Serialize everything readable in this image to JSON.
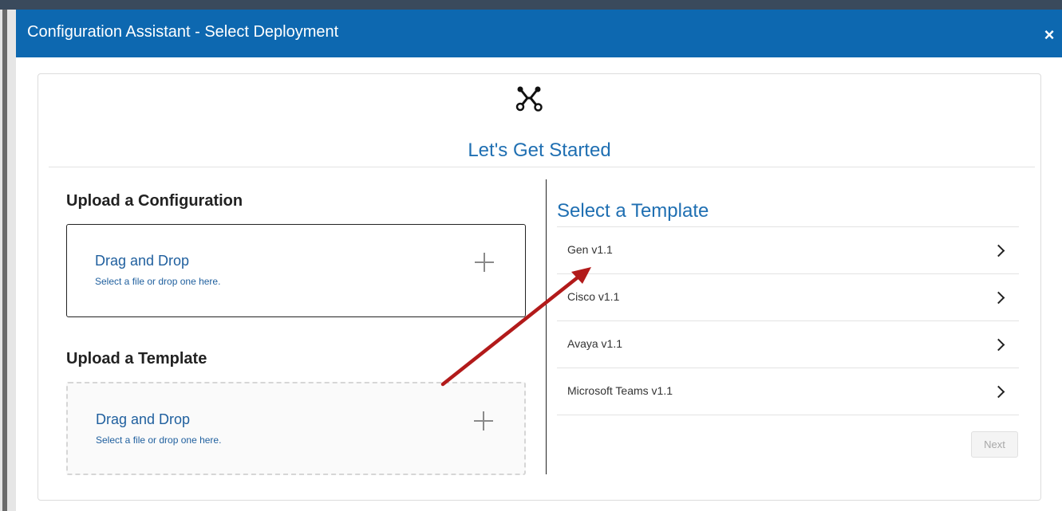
{
  "dialog": {
    "title": "Configuration Assistant - Select Deployment",
    "close_glyph": "×"
  },
  "hero": {
    "icon": "network-nodes-icon",
    "heading": "Let's Get Started"
  },
  "upload_configuration": {
    "title": "Upload a Configuration",
    "dropzone_title": "Drag and Drop",
    "dropzone_hint": "Select a file or drop one here."
  },
  "upload_template": {
    "title": "Upload a Template",
    "dropzone_title": "Drag and Drop",
    "dropzone_hint": "Select a file or drop one here."
  },
  "templates": {
    "title": "Select a Template",
    "items": [
      {
        "label": "Gen v1.1"
      },
      {
        "label": "Cisco v1.1"
      },
      {
        "label": "Avaya v1.1"
      },
      {
        "label": "Microsoft Teams v1.1"
      }
    ],
    "next_label": "Next"
  },
  "colors": {
    "titlebar": "#0d68b0",
    "accent_text": "#1f6fb2",
    "annotation_arrow": "#b21a1a"
  }
}
